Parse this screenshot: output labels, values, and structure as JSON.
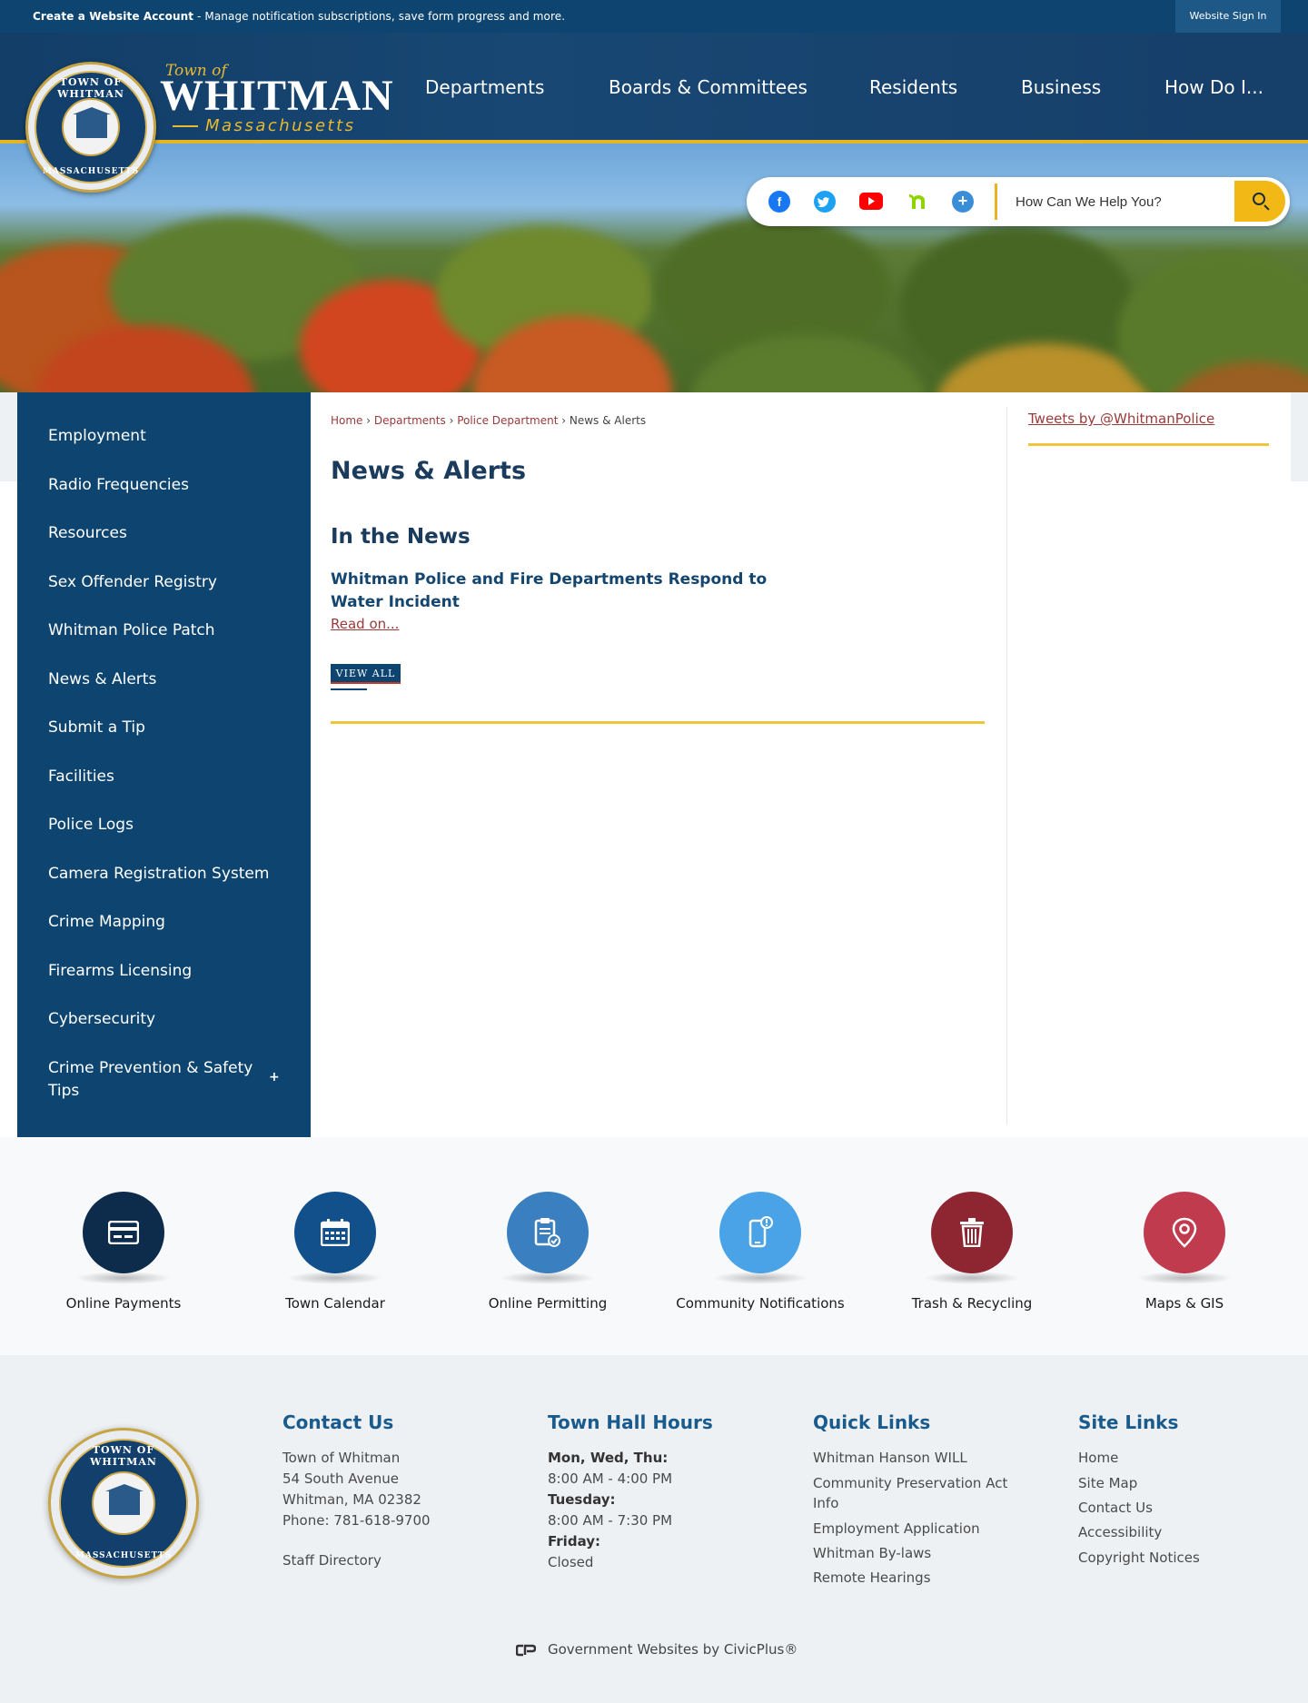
{
  "topbar": {
    "create_account": "Create a Website Account",
    "create_desc": " - Manage notification subscriptions, save form progress and more.",
    "signin": "Website Sign In"
  },
  "brand": {
    "town_of": "Town of",
    "name": "WHITMAN",
    "state": "Massachusetts",
    "seal_top": "TOWN OF WHITMAN",
    "seal_bottom": "MASSACHUSETTS"
  },
  "nav": [
    "Departments",
    "Boards & Committees",
    "Residents",
    "Business",
    "How Do I..."
  ],
  "social": {
    "icons": [
      "facebook-icon",
      "twitter-icon",
      "youtube-icon",
      "nextdoor-icon",
      "more-icon"
    ],
    "colors": {
      "facebook": "#1877f2",
      "twitter": "#1da1f2",
      "youtube": "#ff0000",
      "nextdoor": "#8ed500",
      "more": "#3a8ed8"
    }
  },
  "search": {
    "placeholder": "How Can We Help You?"
  },
  "sidebar": {
    "items": [
      "Employment",
      "Radio Frequencies",
      "Resources",
      "Sex Offender Registry",
      "Whitman Police Patch",
      "News & Alerts",
      "Submit a Tip",
      "Facilities",
      "Police Logs",
      "Camera Registration System",
      "Crime Mapping",
      "Firearms Licensing",
      "Cybersecurity",
      "Crime Prevention & Safety Tips"
    ],
    "expand": "+"
  },
  "breadcrumb": {
    "home": "Home",
    "departments": "Departments",
    "police": "Police Department",
    "current": "News & Alerts",
    "sep": " › "
  },
  "main": {
    "title": "News & Alerts",
    "subtitle": "In the News",
    "news_title": "Whitman Police and Fire Departments Respond to Water Incident",
    "read_on": "Read on...",
    "view_all": "VIEW ALL"
  },
  "aside": {
    "tweets": "Tweets by @WhitmanPolice"
  },
  "quick_links": [
    {
      "label": "Online Payments",
      "color": "#0d2c4b",
      "icon": "payment-card-icon"
    },
    {
      "label": "Town Calendar",
      "color": "#11508a",
      "icon": "calendar-icon"
    },
    {
      "label": "Online Permitting",
      "color": "#3a7fbf",
      "icon": "clipboard-check-icon"
    },
    {
      "label": "Community Notifications",
      "color": "#4aa3e6",
      "icon": "phone-alert-icon"
    },
    {
      "label": "Trash & Recycling",
      "color": "#8e2632",
      "icon": "trash-icon"
    },
    {
      "label": "Maps & GIS",
      "color": "#c13b4e",
      "icon": "map-pin-icon"
    }
  ],
  "footer": {
    "contact": {
      "title": "Contact Us",
      "lines": [
        "Town of Whitman",
        "54 South Avenue",
        "Whitman, MA 02382",
        "Phone: 781-618-9700"
      ],
      "staff": "Staff Directory"
    },
    "hours": {
      "title": "Town Hall Hours",
      "rows": [
        {
          "day": "Mon, Wed, Thu:",
          "time": "8:00 AM - 4:00 PM"
        },
        {
          "day": "Tuesday:",
          "time": "8:00 AM - 7:30 PM"
        },
        {
          "day": "Friday:",
          "time": "Closed"
        }
      ]
    },
    "quick": {
      "title": "Quick Links",
      "items": [
        "Whitman Hanson WILL",
        "Community Preservation Act Info",
        "Employment Application",
        "Whitman By-laws",
        "Remote Hearings"
      ]
    },
    "site": {
      "title": "Site Links",
      "items": [
        "Home",
        "Site Map",
        "Contact Us",
        "Accessibility",
        "Copyright Notices"
      ]
    },
    "credit": "Government Websites by CivicPlus®"
  }
}
